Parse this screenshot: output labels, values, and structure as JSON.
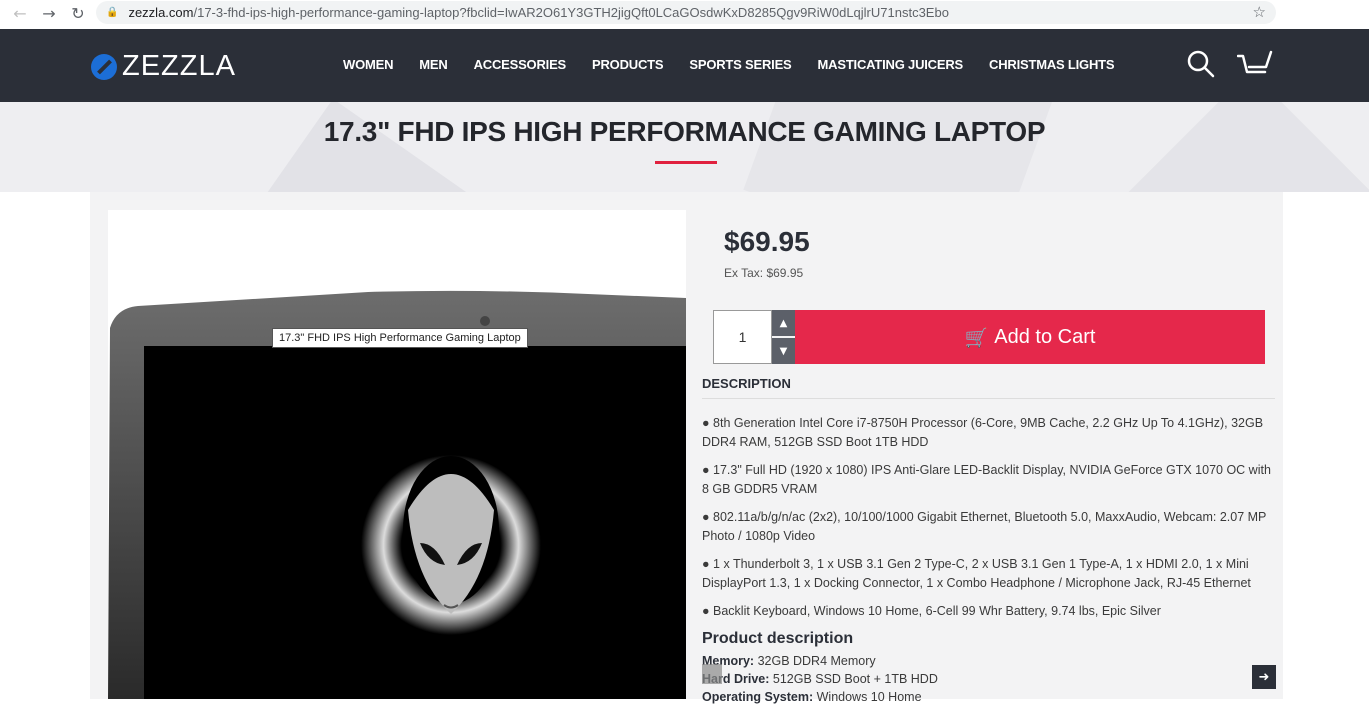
{
  "browser": {
    "back_icon": "←",
    "forward_icon": "→",
    "reload_icon": "↻",
    "lock_icon": "🔒",
    "host": "zezzla.com",
    "path": "/17-3-fhd-ips-high-performance-gaming-laptop?fbclid=IwAR2O61Y3GTH2jigQft0LCaGOsdwKxD8285Qgv9RiW0dLqjlrU71nstc3Ebo",
    "star_icon": "☆"
  },
  "header": {
    "logo_text": "ZEZZLA",
    "menu": [
      "WOMEN",
      "MEN",
      "ACCESSORIES",
      "PRODUCTS",
      "SPORTS SERIES",
      "MASTICATING JUICERS",
      "CHRISTMAS LIGHTS"
    ]
  },
  "hero": {
    "title": "17.3\" FHD IPS HIGH PERFORMANCE GAMING LAPTOP"
  },
  "product": {
    "tooltip": "17.3\" FHD IPS High Performance Gaming Laptop",
    "price": "$69.95",
    "ex_tax": "Ex Tax: $69.95",
    "quantity": "1",
    "qty_up": "▲",
    "qty_down": "▼",
    "cart_icon": "🛒",
    "add_to_cart": "Add to Cart",
    "description_heading": "DESCRIPTION",
    "bullets": [
      "● 8th Generation Intel Core i7-8750H Processor (6-Core, 9MB Cache, 2.2 GHz Up To 4.1GHz), 32GB DDR4 RAM, 512GB SSD Boot   1TB HDD",
      "● 17.3\" Full HD (1920 x 1080) IPS Anti-Glare LED-Backlit Display, NVIDIA GeForce GTX 1070 OC with 8 GB GDDR5 VRAM",
      "● 802.11a/b/g/n/ac (2x2), 10/100/1000 Gigabit Ethernet, Bluetooth 5.0, MaxxAudio, Webcam: 2.07 MP Photo / 1080p Video",
      "● 1 x Thunderbolt 3, 1 x USB 3.1 Gen 2 Type-C, 2 x USB 3.1 Gen 1 Type-A, 1 x HDMI 2.0, 1 x Mini DisplayPort 1.3, 1 x Docking Connector, 1 x Combo Headphone / Microphone Jack, RJ-45 Ethernet",
      "● Backlit Keyboard, Windows 10 Home, 6-Cell 99 Whr Battery, 9.74 lbs, Epic Silver"
    ],
    "product_description_heading": "Product description",
    "specs": [
      {
        "label": "Memory:",
        "value": " 32GB DDR4 Memory"
      },
      {
        "label": "Hard Drive:",
        "value": " 512GB SSD Boot + 1TB HDD"
      },
      {
        "label": "Operating System:",
        "value": " Windows 10 Home"
      }
    ],
    "next_icon": "➜"
  },
  "colors": {
    "header_bg": "#2b2f38",
    "accent_red": "#e5284b",
    "logo_blue": "#1c6ed6"
  }
}
